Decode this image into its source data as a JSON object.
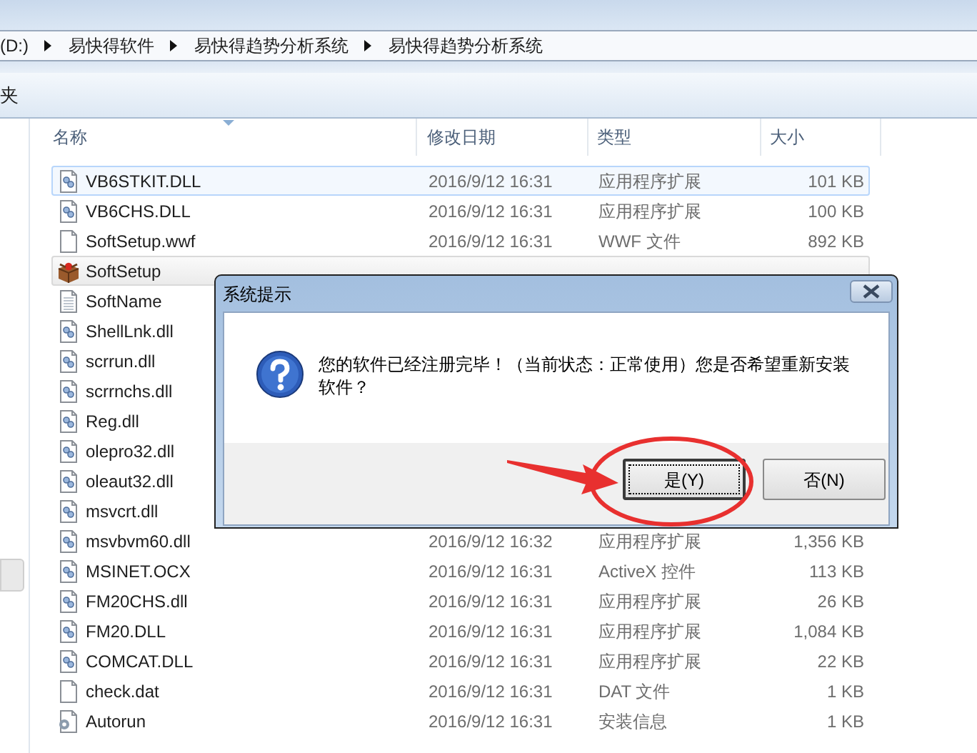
{
  "address_bar": {
    "path": [
      "(D:)",
      "易快得软件",
      "易快得趋势分析系统",
      "易快得趋势分析系统"
    ]
  },
  "toolbar": {
    "label": "夹"
  },
  "columns": [
    "名称",
    "修改日期",
    "类型",
    "大小"
  ],
  "files": [
    {
      "name": "VB6STKIT.DLL",
      "modified": "2016/9/12 16:31",
      "type": "应用程序扩展",
      "size": "101 KB",
      "kind": "dll",
      "selected": false,
      "hovered": true
    },
    {
      "name": "VB6CHS.DLL",
      "modified": "2016/9/12 16:31",
      "type": "应用程序扩展",
      "size": "100 KB",
      "kind": "dll",
      "selected": false,
      "hovered": false
    },
    {
      "name": "SoftSetup.wwf",
      "modified": "2016/9/12 16:31",
      "type": "WWF 文件",
      "size": "892 KB",
      "kind": "file",
      "selected": false,
      "hovered": false
    },
    {
      "name": "SoftSetup",
      "kind": "installer",
      "selected": true,
      "hovered": false
    },
    {
      "name": "SoftName",
      "kind": "text",
      "selected": false,
      "hovered": false
    },
    {
      "name": "ShellLnk.dll",
      "kind": "dll",
      "selected": false,
      "hovered": false
    },
    {
      "name": "scrrun.dll",
      "kind": "dll",
      "selected": false,
      "hovered": false
    },
    {
      "name": "scrrnchs.dll",
      "kind": "dll",
      "selected": false,
      "hovered": false
    },
    {
      "name": "Reg.dll",
      "kind": "dll",
      "selected": false,
      "hovered": false
    },
    {
      "name": "olepro32.dll",
      "kind": "dll",
      "selected": false,
      "hovered": false
    },
    {
      "name": "oleaut32.dll",
      "kind": "dll",
      "selected": false,
      "hovered": false
    },
    {
      "name": "msvcrt.dll",
      "kind": "dll",
      "selected": false,
      "hovered": false
    },
    {
      "name": "msvbvm60.dll",
      "modified": "2016/9/12 16:32",
      "type": "应用程序扩展",
      "size": "1,356 KB",
      "kind": "dll",
      "selected": false,
      "hovered": false
    },
    {
      "name": "MSINET.OCX",
      "modified": "2016/9/12 16:31",
      "type": "ActiveX 控件",
      "size": "113 KB",
      "kind": "dll",
      "selected": false,
      "hovered": false
    },
    {
      "name": "FM20CHS.dll",
      "modified": "2016/9/12 16:31",
      "type": "应用程序扩展",
      "size": "26 KB",
      "kind": "dll",
      "selected": false,
      "hovered": false
    },
    {
      "name": "FM20.DLL",
      "modified": "2016/9/12 16:31",
      "type": "应用程序扩展",
      "size": "1,084 KB",
      "kind": "dll",
      "selected": false,
      "hovered": false
    },
    {
      "name": "COMCAT.DLL",
      "modified": "2016/9/12 16:31",
      "type": "应用程序扩展",
      "size": "22 KB",
      "kind": "dll",
      "selected": false,
      "hovered": false
    },
    {
      "name": "check.dat",
      "modified": "2016/9/12 16:31",
      "type": "DAT 文件",
      "size": "1 KB",
      "kind": "file",
      "selected": false,
      "hovered": false
    },
    {
      "name": "Autorun",
      "modified": "2016/9/12 16:31",
      "type": "安装信息",
      "size": "1 KB",
      "kind": "config",
      "selected": false,
      "hovered": false
    }
  ],
  "dialog": {
    "title": "系统提示",
    "message": "您的软件已经注册完毕！（当前状态：正常使用）您是否希望重新安装软件？",
    "buttons": [
      {
        "label": "是(Y)",
        "focused": true
      },
      {
        "label": "否(N)",
        "focused": false
      }
    ]
  }
}
